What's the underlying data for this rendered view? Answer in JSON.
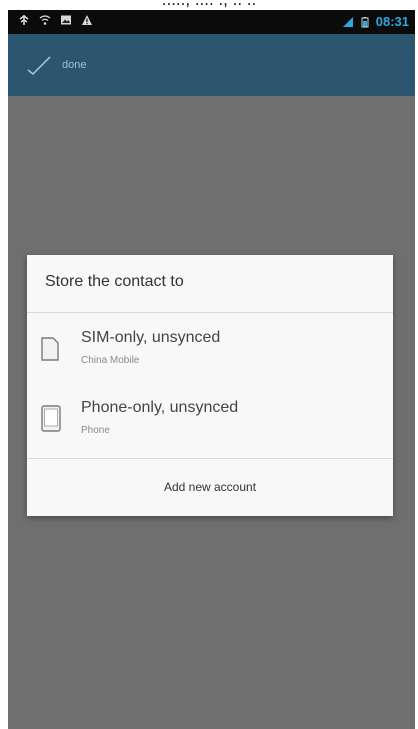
{
  "top_caption": "....., .... ., .. ..",
  "status_bar": {
    "left_icons": [
      "usb-icon",
      "wifi-icon",
      "image-icon",
      "warning-icon"
    ],
    "right_icons": [
      "signal-icon",
      "battery-icon"
    ],
    "time": "08:31"
  },
  "action_bar": {
    "done_label": "DONE"
  },
  "dialog": {
    "title": "Store the contact to",
    "accounts": [
      {
        "name": "SIM-only, unsynced",
        "sub": "China Mobile",
        "icon": "sim-card-icon"
      },
      {
        "name": "Phone-only, unsynced",
        "sub": "Phone",
        "icon": "phone-icon"
      }
    ],
    "add_account_label": "Add new account"
  },
  "colors": {
    "status_bar": "#0b0b0b",
    "action_bar": "#2c5670",
    "scrim": "#6f6f6f",
    "dialog_bg": "#f8f8f8",
    "time": "#2fa6e0"
  }
}
